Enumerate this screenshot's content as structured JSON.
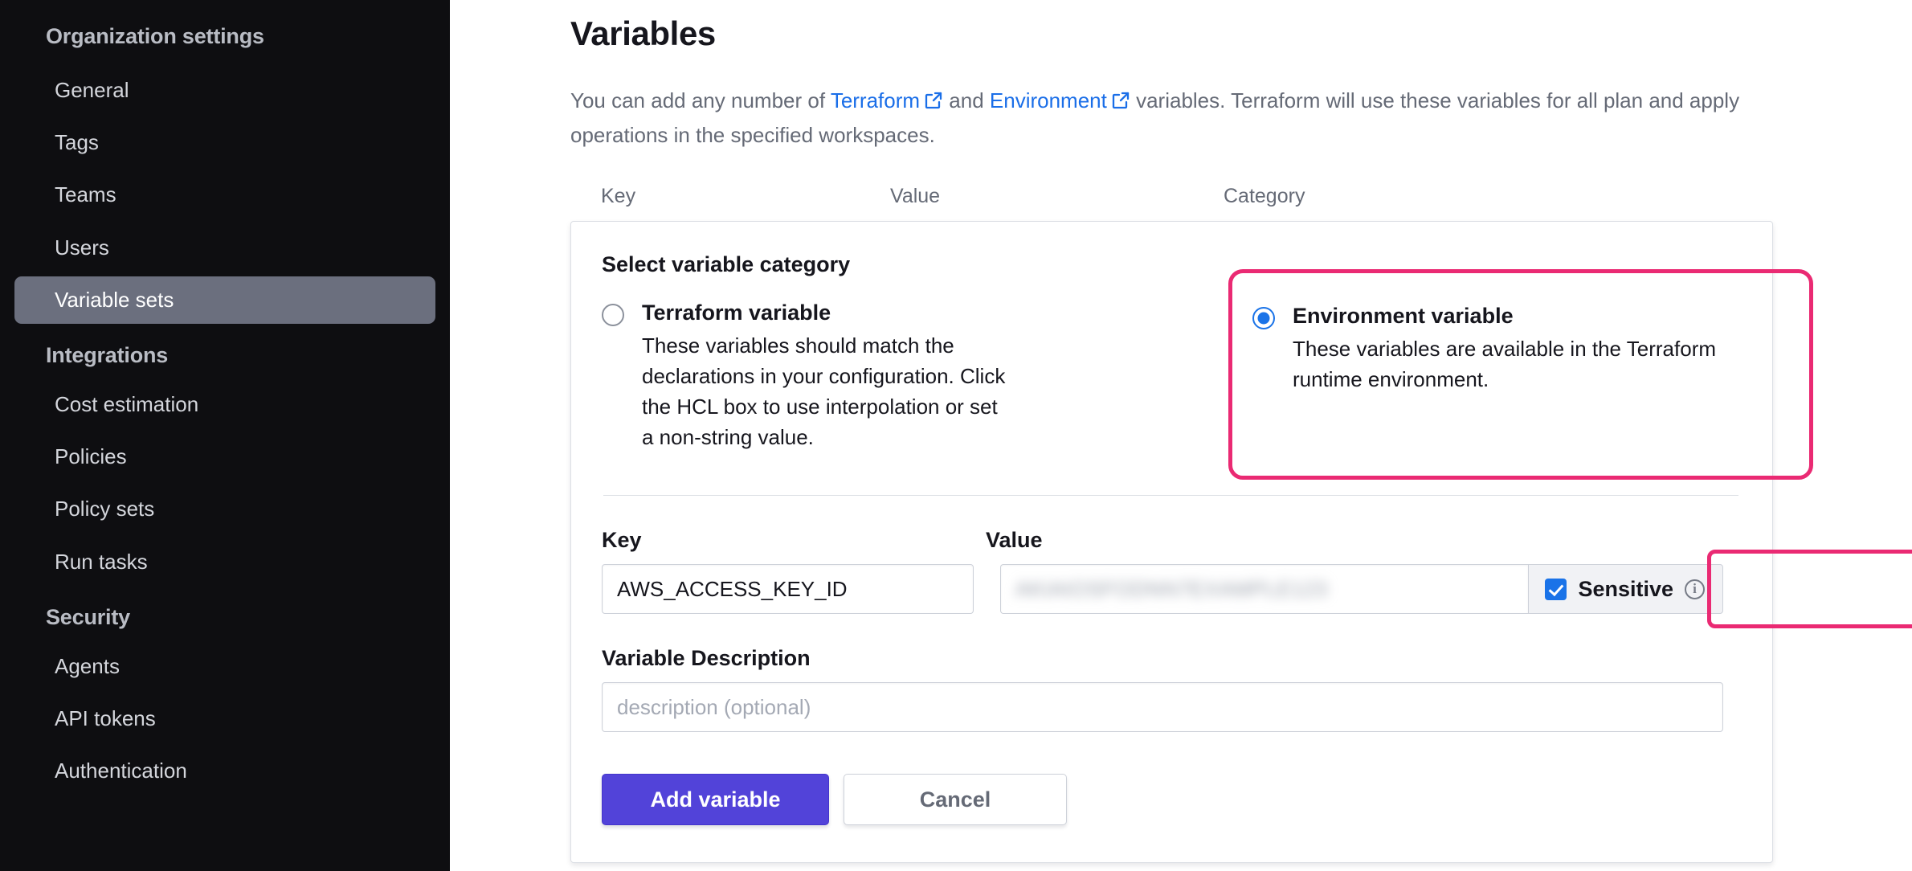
{
  "sidebar": {
    "heading": "Organization settings",
    "items": [
      {
        "label": "General",
        "active": false
      },
      {
        "label": "Tags",
        "active": false
      },
      {
        "label": "Teams",
        "active": false
      },
      {
        "label": "Users",
        "active": false
      },
      {
        "label": "Variable sets",
        "active": true
      }
    ],
    "integrations_heading": "Integrations",
    "integrations_items": [
      {
        "label": "Cost estimation"
      },
      {
        "label": "Policies"
      },
      {
        "label": "Policy sets"
      },
      {
        "label": "Run tasks"
      }
    ],
    "security_heading": "Security",
    "security_items": [
      {
        "label": "Agents"
      },
      {
        "label": "API tokens"
      },
      {
        "label": "Authentication"
      }
    ]
  },
  "main": {
    "title": "Variables",
    "description": {
      "part1": "You can add any number of ",
      "link1": "Terraform",
      "part2": " and ",
      "link2": "Environment",
      "part3": " variables. Terraform will use these variables for all plan and apply operations in the specified workspaces."
    },
    "columns": {
      "key": "Key",
      "value": "Value",
      "category": "Category"
    }
  },
  "form": {
    "category_title": "Select variable category",
    "options": [
      {
        "title": "Terraform variable",
        "description": "These variables should match the declarations in your configuration. Click the HCL box to use interpolation or set a non-string value.",
        "selected": false
      },
      {
        "title": "Environment variable",
        "description": "These variables are available in the Terraform runtime environment.",
        "selected": true
      }
    ],
    "key_label": "Key",
    "key_value": "AWS_ACCESS_KEY_ID",
    "value_label": "Value",
    "value_value": "AKIAIOSFODNN7EXAMPLE123",
    "value_redacted": true,
    "sensitive_label": "Sensitive",
    "sensitive_checked": true,
    "info_icon_glyph": "i",
    "description_label": "Variable Description",
    "description_placeholder": "description (optional)",
    "description_value": "",
    "add_button": "Add variable",
    "cancel_button": "Cancel"
  },
  "highlights": {
    "color": "#ea2a73",
    "targets": [
      "environment-variable-option",
      "sensitive-checkbox"
    ]
  },
  "colors": {
    "sidebar_bg": "#0e0e11",
    "sidebar_active_bg": "#6b6f7e",
    "link": "#1a6ee8",
    "primary_button": "#5243d9",
    "checkbox_blue": "#1a73e8",
    "highlight_pink": "#ea2a73"
  }
}
